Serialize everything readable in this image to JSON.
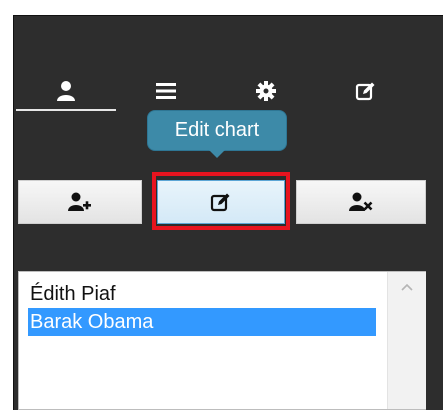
{
  "tabs": [
    {
      "name": "user-icon",
      "active": true
    },
    {
      "name": "menu-icon",
      "active": false
    },
    {
      "name": "gear-icon",
      "active": false
    },
    {
      "name": "edit-icon",
      "active": false
    }
  ],
  "tooltip": {
    "text": "Edit chart"
  },
  "toolbar": {
    "add_user": {
      "icon": "add-user-icon"
    },
    "edit": {
      "icon": "edit-icon",
      "highlighted": true
    },
    "remove_user": {
      "icon": "remove-user-icon"
    }
  },
  "list": {
    "items": [
      {
        "label": "Édith Piaf",
        "selected": false
      },
      {
        "label": "Barak Obama",
        "selected": true
      }
    ]
  },
  "colors": {
    "panel_bg": "#2d2d2d",
    "tooltip_bg": "#3d8aa8",
    "selection": "#3399ff",
    "highlight_border": "#e8141f"
  }
}
